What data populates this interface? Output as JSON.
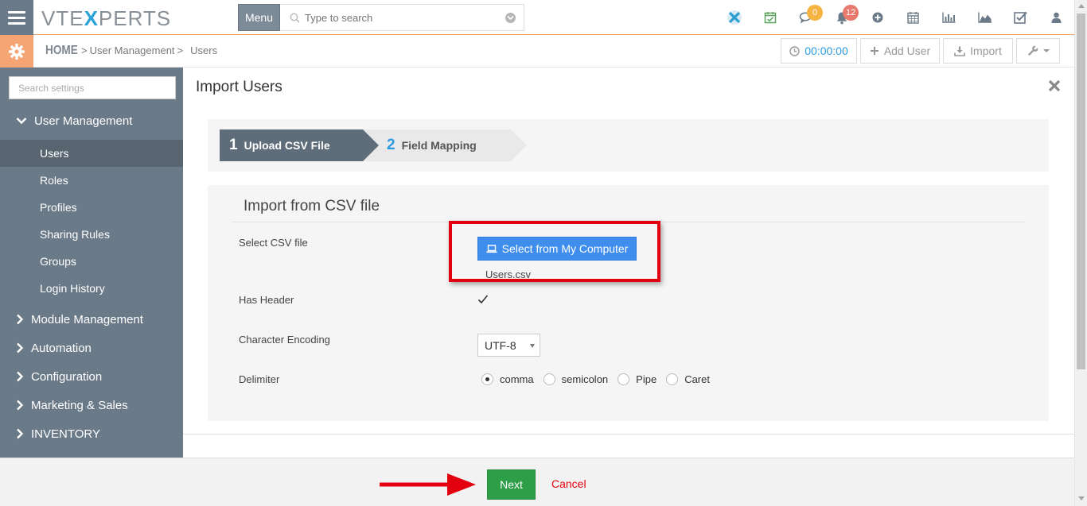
{
  "topbar": {
    "logo_prefix": "VTE",
    "logo_x": "X",
    "logo_suffix": "PERTS",
    "menu_label": "Menu",
    "search_placeholder": "Type to search",
    "icons": [
      {
        "name": "vtexperts-x-icon"
      },
      {
        "name": "calendar-check-icon"
      },
      {
        "name": "chat-bubbles-icon",
        "badge": "0",
        "badge_color": "#f5b342"
      },
      {
        "name": "bell-icon",
        "badge": "12",
        "badge_color": "#e8796d"
      },
      {
        "name": "plus-circle-icon"
      },
      {
        "name": "calendar-icon"
      },
      {
        "name": "bar-chart-icon"
      },
      {
        "name": "area-chart-icon"
      },
      {
        "name": "checkbox-icon"
      },
      {
        "name": "user-icon"
      }
    ]
  },
  "subbar": {
    "breadcrumb": {
      "home": "HOME",
      "level1": "User Management",
      "level2": "Users"
    },
    "timer": "00:00:00",
    "add_user": "Add User",
    "import": "Import"
  },
  "sidebar": {
    "search_placeholder": "Search settings",
    "sections": [
      {
        "label": "User Management",
        "expanded": true
      },
      {
        "label": "Module Management",
        "expanded": false
      },
      {
        "label": "Automation",
        "expanded": false
      },
      {
        "label": "Configuration",
        "expanded": false
      },
      {
        "label": "Marketing & Sales",
        "expanded": false
      },
      {
        "label": "INVENTORY",
        "expanded": false
      }
    ],
    "items": [
      {
        "label": "Users",
        "active": true
      },
      {
        "label": "Roles"
      },
      {
        "label": "Profiles"
      },
      {
        "label": "Sharing Rules"
      },
      {
        "label": "Groups"
      },
      {
        "label": "Login History"
      }
    ]
  },
  "main": {
    "title": "Import Users",
    "wizard": {
      "step1_num": "1",
      "step1_label": "Upload CSV File",
      "step2_num": "2",
      "step2_label": "Field Mapping"
    },
    "import_heading": "Import from CSV file",
    "fields": {
      "select_csv_label": "Select CSV file",
      "select_button": "Select from My Computer",
      "filename": "Users.csv",
      "has_header_label": "Has Header",
      "has_header_checked": true,
      "encoding_label": "Character Encoding",
      "encoding_value": "UTF-8",
      "delimiter_label": "Delimiter",
      "delimiter_options": [
        "comma",
        "semicolon",
        "Pipe",
        "Caret"
      ],
      "delimiter_selected": "comma"
    }
  },
  "footer": {
    "next_label": "Next",
    "cancel_label": "Cancel"
  },
  "colors": {
    "sidebar_bg": "#6b7a89",
    "accent_orange": "#f5a474",
    "primary_blue": "#3f8ded",
    "success_green": "#2e9e48",
    "highlight_red": "#e3000f"
  }
}
